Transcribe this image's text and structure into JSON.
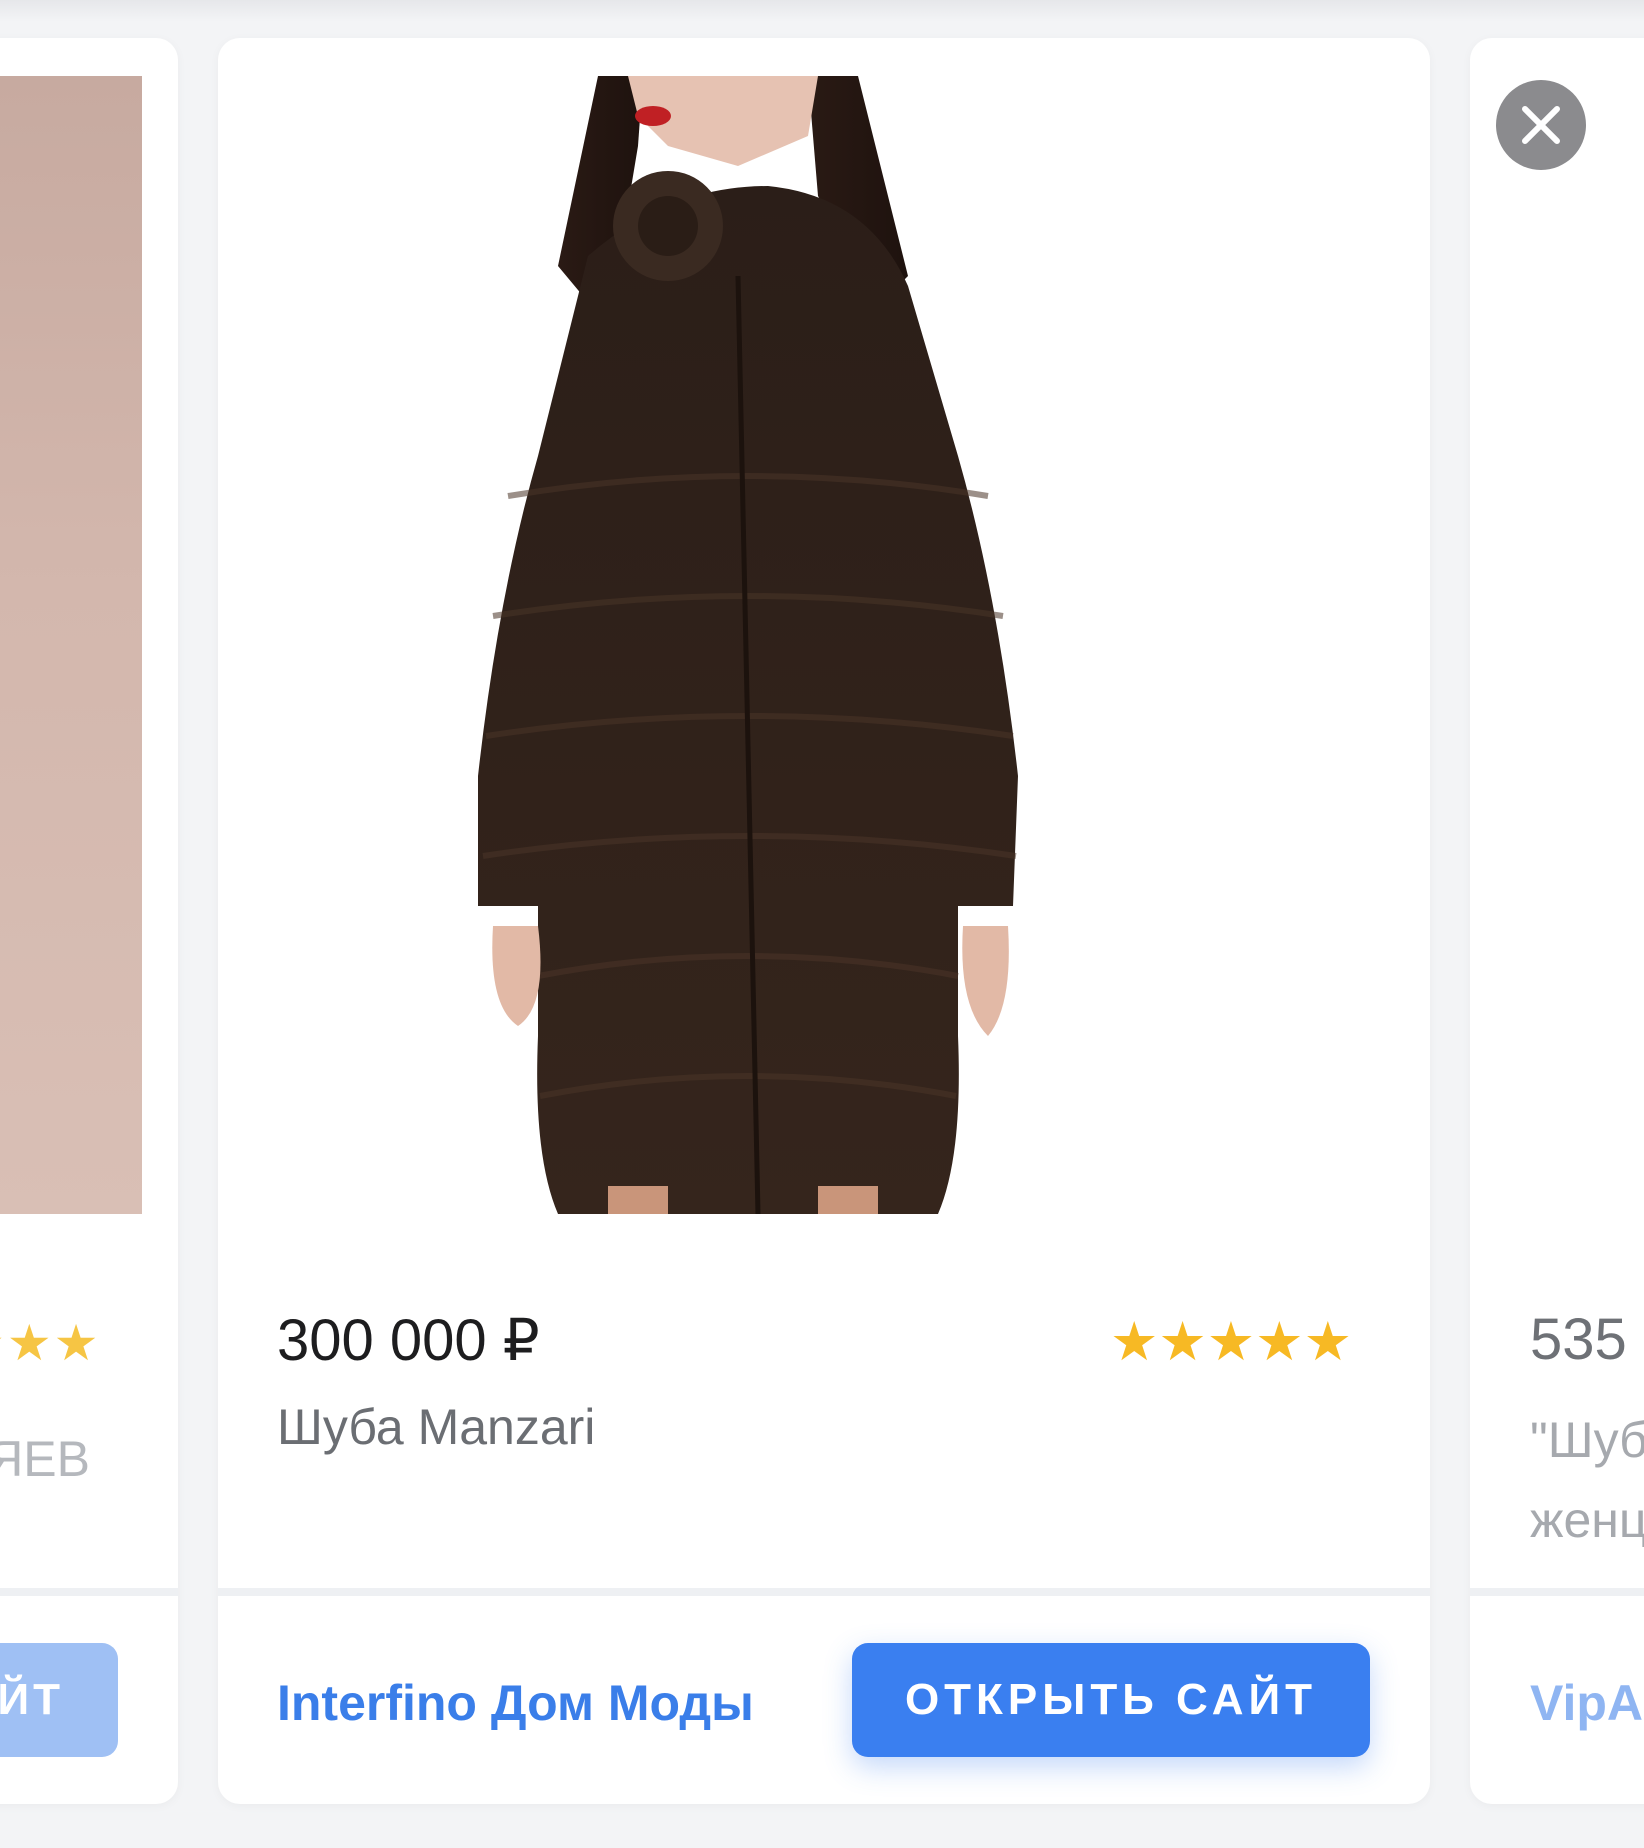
{
  "left_card": {
    "stars": "★★★",
    "subtitle": "ЯЕВ",
    "button_label": "ЙТ"
  },
  "main_card": {
    "price": "300 000 ₽",
    "rating_stars": "★★★★★",
    "title": "Шуба Manzari",
    "store_name": "Interfino Дом Моды",
    "open_button_label": "ОТКРЫТЬ САЙТ",
    "image_icon": "fur-coat-product-photo"
  },
  "right_card": {
    "price": "535",
    "title_line1": "\"Шуб",
    "title_line2": "женц",
    "store_name": "VipA",
    "close_icon": "close-icon"
  },
  "colors": {
    "accent": "#3a7ff0",
    "link": "#3a7ee9",
    "star": "#f7b924",
    "close_bg": "#8b8b8e"
  }
}
